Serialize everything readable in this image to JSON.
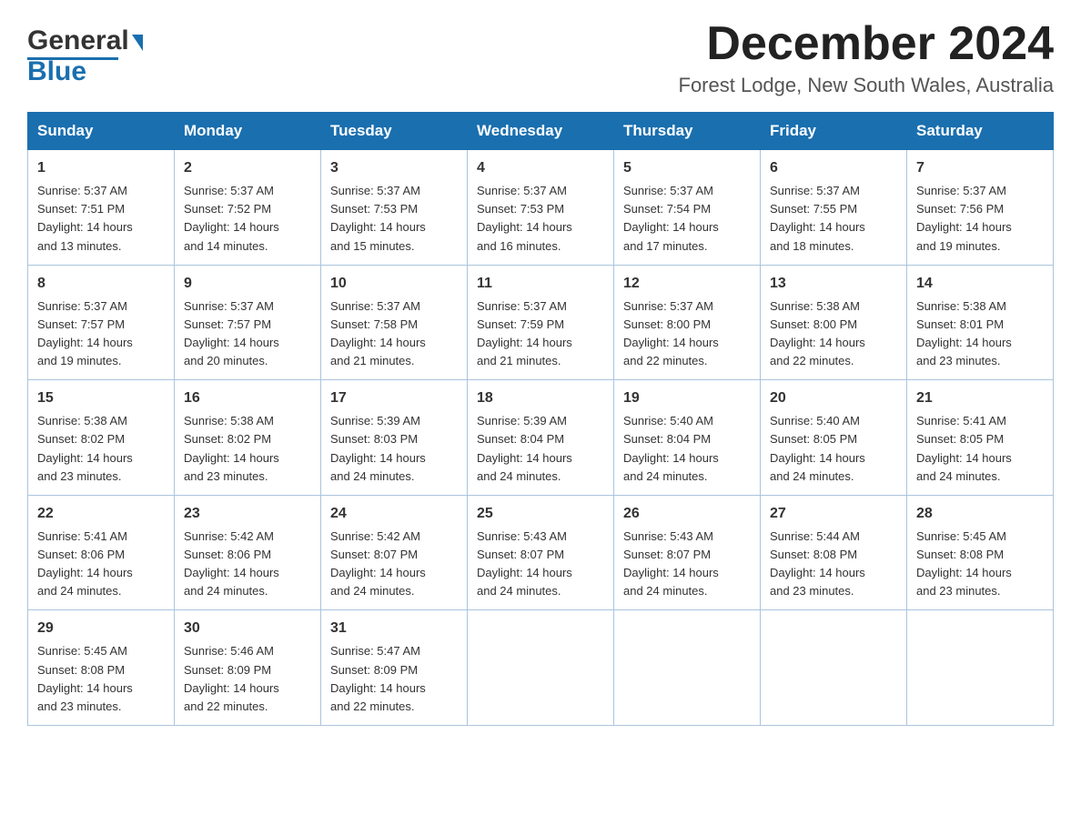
{
  "logo": {
    "text_general": "General",
    "text_blue": "Blue",
    "triangle_char": "▶"
  },
  "header": {
    "month_year": "December 2024",
    "location": "Forest Lodge, New South Wales, Australia"
  },
  "weekdays": [
    "Sunday",
    "Monday",
    "Tuesday",
    "Wednesday",
    "Thursday",
    "Friday",
    "Saturday"
  ],
  "weeks": [
    [
      {
        "day": "1",
        "sunrise": "5:37 AM",
        "sunset": "7:51 PM",
        "daylight": "14 hours and 13 minutes."
      },
      {
        "day": "2",
        "sunrise": "5:37 AM",
        "sunset": "7:52 PM",
        "daylight": "14 hours and 14 minutes."
      },
      {
        "day": "3",
        "sunrise": "5:37 AM",
        "sunset": "7:53 PM",
        "daylight": "14 hours and 15 minutes."
      },
      {
        "day": "4",
        "sunrise": "5:37 AM",
        "sunset": "7:53 PM",
        "daylight": "14 hours and 16 minutes."
      },
      {
        "day": "5",
        "sunrise": "5:37 AM",
        "sunset": "7:54 PM",
        "daylight": "14 hours and 17 minutes."
      },
      {
        "day": "6",
        "sunrise": "5:37 AM",
        "sunset": "7:55 PM",
        "daylight": "14 hours and 18 minutes."
      },
      {
        "day": "7",
        "sunrise": "5:37 AM",
        "sunset": "7:56 PM",
        "daylight": "14 hours and 19 minutes."
      }
    ],
    [
      {
        "day": "8",
        "sunrise": "5:37 AM",
        "sunset": "7:57 PM",
        "daylight": "14 hours and 19 minutes."
      },
      {
        "day": "9",
        "sunrise": "5:37 AM",
        "sunset": "7:57 PM",
        "daylight": "14 hours and 20 minutes."
      },
      {
        "day": "10",
        "sunrise": "5:37 AM",
        "sunset": "7:58 PM",
        "daylight": "14 hours and 21 minutes."
      },
      {
        "day": "11",
        "sunrise": "5:37 AM",
        "sunset": "7:59 PM",
        "daylight": "14 hours and 21 minutes."
      },
      {
        "day": "12",
        "sunrise": "5:37 AM",
        "sunset": "8:00 PM",
        "daylight": "14 hours and 22 minutes."
      },
      {
        "day": "13",
        "sunrise": "5:38 AM",
        "sunset": "8:00 PM",
        "daylight": "14 hours and 22 minutes."
      },
      {
        "day": "14",
        "sunrise": "5:38 AM",
        "sunset": "8:01 PM",
        "daylight": "14 hours and 23 minutes."
      }
    ],
    [
      {
        "day": "15",
        "sunrise": "5:38 AM",
        "sunset": "8:02 PM",
        "daylight": "14 hours and 23 minutes."
      },
      {
        "day": "16",
        "sunrise": "5:38 AM",
        "sunset": "8:02 PM",
        "daylight": "14 hours and 23 minutes."
      },
      {
        "day": "17",
        "sunrise": "5:39 AM",
        "sunset": "8:03 PM",
        "daylight": "14 hours and 24 minutes."
      },
      {
        "day": "18",
        "sunrise": "5:39 AM",
        "sunset": "8:04 PM",
        "daylight": "14 hours and 24 minutes."
      },
      {
        "day": "19",
        "sunrise": "5:40 AM",
        "sunset": "8:04 PM",
        "daylight": "14 hours and 24 minutes."
      },
      {
        "day": "20",
        "sunrise": "5:40 AM",
        "sunset": "8:05 PM",
        "daylight": "14 hours and 24 minutes."
      },
      {
        "day": "21",
        "sunrise": "5:41 AM",
        "sunset": "8:05 PM",
        "daylight": "14 hours and 24 minutes."
      }
    ],
    [
      {
        "day": "22",
        "sunrise": "5:41 AM",
        "sunset": "8:06 PM",
        "daylight": "14 hours and 24 minutes."
      },
      {
        "day": "23",
        "sunrise": "5:42 AM",
        "sunset": "8:06 PM",
        "daylight": "14 hours and 24 minutes."
      },
      {
        "day": "24",
        "sunrise": "5:42 AM",
        "sunset": "8:07 PM",
        "daylight": "14 hours and 24 minutes."
      },
      {
        "day": "25",
        "sunrise": "5:43 AM",
        "sunset": "8:07 PM",
        "daylight": "14 hours and 24 minutes."
      },
      {
        "day": "26",
        "sunrise": "5:43 AM",
        "sunset": "8:07 PM",
        "daylight": "14 hours and 24 minutes."
      },
      {
        "day": "27",
        "sunrise": "5:44 AM",
        "sunset": "8:08 PM",
        "daylight": "14 hours and 23 minutes."
      },
      {
        "day": "28",
        "sunrise": "5:45 AM",
        "sunset": "8:08 PM",
        "daylight": "14 hours and 23 minutes."
      }
    ],
    [
      {
        "day": "29",
        "sunrise": "5:45 AM",
        "sunset": "8:08 PM",
        "daylight": "14 hours and 23 minutes."
      },
      {
        "day": "30",
        "sunrise": "5:46 AM",
        "sunset": "8:09 PM",
        "daylight": "14 hours and 22 minutes."
      },
      {
        "day": "31",
        "sunrise": "5:47 AM",
        "sunset": "8:09 PM",
        "daylight": "14 hours and 22 minutes."
      },
      null,
      null,
      null,
      null
    ]
  ],
  "labels": {
    "sunrise": "Sunrise:",
    "sunset": "Sunset:",
    "daylight": "Daylight:"
  }
}
